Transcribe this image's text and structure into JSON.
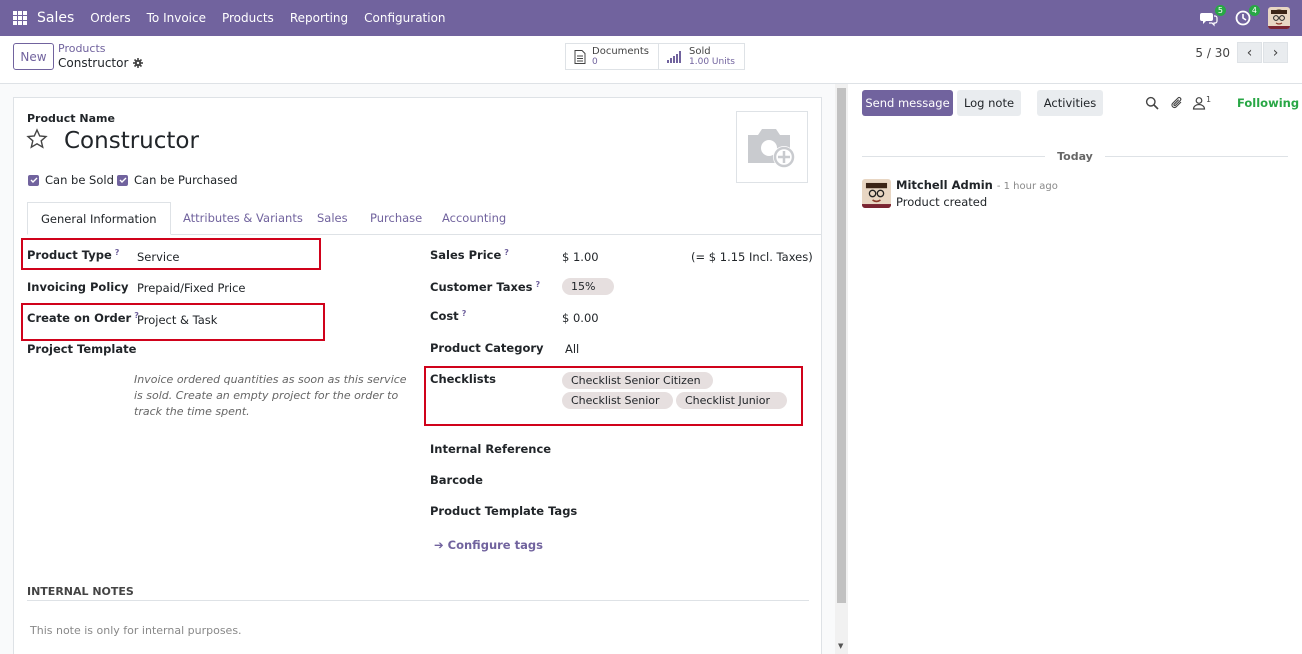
{
  "navbar": {
    "app_name": "Sales",
    "menu": [
      "Orders",
      "To Invoice",
      "Products",
      "Reporting",
      "Configuration"
    ],
    "messages_count": "5",
    "activities_count": "4"
  },
  "control": {
    "new_label": "New",
    "breadcrumb_parent": "Products",
    "breadcrumb_current": "Constructor",
    "documents_label": "Documents",
    "documents_value": "0",
    "sold_label": "Sold",
    "sold_value": "1.00 Units",
    "pager": "5 / 30"
  },
  "form": {
    "name_label": "Product Name",
    "name": "Constructor",
    "can_be_sold": "Can be Sold",
    "can_be_purchased": "Can be Purchased",
    "tabs": [
      "General Information",
      "Attributes & Variants",
      "Sales",
      "Purchase",
      "Accounting"
    ],
    "left_fields": {
      "product_type_label": "Product Type",
      "product_type": "Service",
      "invoicing_policy_label": "Invoicing Policy",
      "invoicing_policy": "Prepaid/Fixed Price",
      "create_on_order_label": "Create on Order",
      "create_on_order": "Project & Task",
      "project_template_label": "Project Template",
      "help_text": "Invoice ordered quantities as soon as this service is sold. Create an empty project for the order to track the time spent."
    },
    "right_fields": {
      "sales_price_label": "Sales Price",
      "sales_price": "$ 1.00",
      "incl_taxes": "(= $ 1.15 Incl. Taxes)",
      "customer_taxes_label": "Customer Taxes",
      "customer_taxes": "15%",
      "cost_label": "Cost",
      "cost": "$ 0.00",
      "product_category_label": "Product Category",
      "product_category": "All",
      "checklists_label": "Checklists",
      "checklists": [
        "Checklist  Senior  Citizen",
        "Checklist  Senior",
        "Checklist  Junior"
      ],
      "internal_reference_label": "Internal Reference",
      "barcode_label": "Barcode",
      "tags_label": "Product Template Tags",
      "configure_tags": "Configure tags"
    },
    "help_mark": "?",
    "internal_notes_header": "INTERNAL NOTES",
    "internal_notes_placeholder": "This note is only for internal purposes."
  },
  "chatter": {
    "send_message": "Send message",
    "log_note": "Log note",
    "activities": "Activities",
    "followers_count": "1",
    "following": "Following",
    "day": "Today",
    "message": {
      "author": "Mitchell Admin",
      "time": "- 1 hour ago",
      "body": "Product created"
    }
  },
  "colors": {
    "brand": "#71639e",
    "highlight_box": "#d0021b",
    "following": "#28a745"
  }
}
